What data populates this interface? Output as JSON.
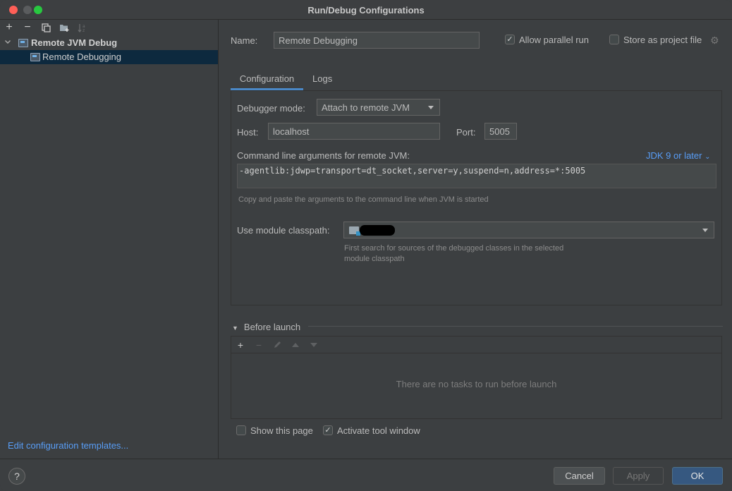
{
  "window": {
    "title": "Run/Debug Configurations"
  },
  "sidebar": {
    "toolbar": [
      "add-icon",
      "remove-icon",
      "copy-icon",
      "new-folder-icon",
      "sort-icon"
    ],
    "tree": {
      "group_label": "Remote JVM Debug",
      "item_label": "Remote Debugging"
    },
    "edit_templates_label": "Edit configuration templates..."
  },
  "form": {
    "name_label": "Name:",
    "name_value": "Remote Debugging",
    "allow_parallel_label": "Allow parallel run",
    "allow_parallel_checked": true,
    "store_project_label": "Store as project file",
    "store_project_checked": false
  },
  "tabs": [
    {
      "label": "Configuration",
      "active": true
    },
    {
      "label": "Logs",
      "active": false
    }
  ],
  "config": {
    "debugger_mode_label": "Debugger mode:",
    "debugger_mode_value": "Attach to remote JVM",
    "host_label": "Host:",
    "host_value": "localhost",
    "port_label": "Port:",
    "port_value": "5005",
    "cmd_label": "Command line arguments for remote JVM:",
    "jdk_link": "JDK 9 or later",
    "cmd_value": "-agentlib:jdwp=transport=dt_socket,server=y,suspend=n,address=*:5005",
    "cmd_hint": "Copy and paste the arguments to the command line when JVM is started",
    "classpath_label": "Use module classpath:",
    "classpath_hint_line1": "First search for sources of the debugged classes in the selected",
    "classpath_hint_line2": "module classpath"
  },
  "before_launch": {
    "title": "Before launch",
    "empty_text": "There are no tasks to run before launch"
  },
  "bottom_options": {
    "show_page_label": "Show this page",
    "show_page_checked": false,
    "activate_tool_label": "Activate tool window",
    "activate_tool_checked": true
  },
  "footer": {
    "help_label": "?",
    "cancel_label": "Cancel",
    "apply_label": "Apply",
    "ok_label": "OK"
  },
  "colors": {
    "background": "#3c3f41",
    "accent": "#589df6",
    "primary_button": "#365880",
    "selection": "#0d293e"
  }
}
